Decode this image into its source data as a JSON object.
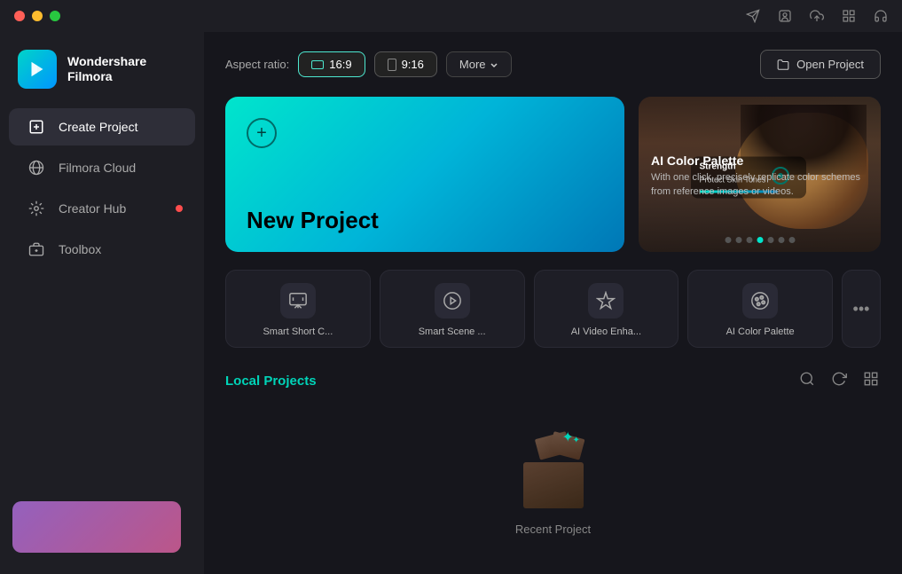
{
  "app": {
    "brand": "Wondershare",
    "product": "Filmora"
  },
  "titlebar": {
    "icons": [
      "send",
      "person-badge",
      "cloud-upload",
      "grid",
      "headset"
    ]
  },
  "sidebar": {
    "items": [
      {
        "id": "create-project",
        "label": "Create Project",
        "active": true
      },
      {
        "id": "filmora-cloud",
        "label": "Filmora Cloud",
        "active": false
      },
      {
        "id": "creator-hub",
        "label": "Creator Hub",
        "active": false,
        "dot": true
      },
      {
        "id": "toolbox",
        "label": "Toolbox",
        "active": false
      }
    ]
  },
  "toolbar": {
    "aspect_ratio_label": "Aspect ratio:",
    "options": [
      {
        "id": "16:9",
        "label": "16:9",
        "active": true
      },
      {
        "id": "9:16",
        "label": "9:16",
        "active": false
      }
    ],
    "more_label": "More",
    "open_project_label": "Open Project"
  },
  "new_project": {
    "title": "New Project"
  },
  "feature_card": {
    "title": "AI Color Palette",
    "description": "With one click, precisely replicate color schemes from reference images or videos.",
    "dots_count": 7,
    "active_dot": 3,
    "badge_title": "Strength",
    "badge_sub": "Protect Skin Tones"
  },
  "ai_tools": [
    {
      "id": "smart-short-clip",
      "label": "Smart Short C...",
      "icon": "✂"
    },
    {
      "id": "smart-scene",
      "label": "Smart Scene ...",
      "icon": "🎬"
    },
    {
      "id": "ai-video-enhance",
      "label": "AI Video Enha...",
      "icon": "✨"
    },
    {
      "id": "ai-color-palette",
      "label": "AI Color Palette",
      "icon": "🎨"
    }
  ],
  "local_projects": {
    "title": "Local Projects",
    "empty_label": "Recent Project"
  }
}
